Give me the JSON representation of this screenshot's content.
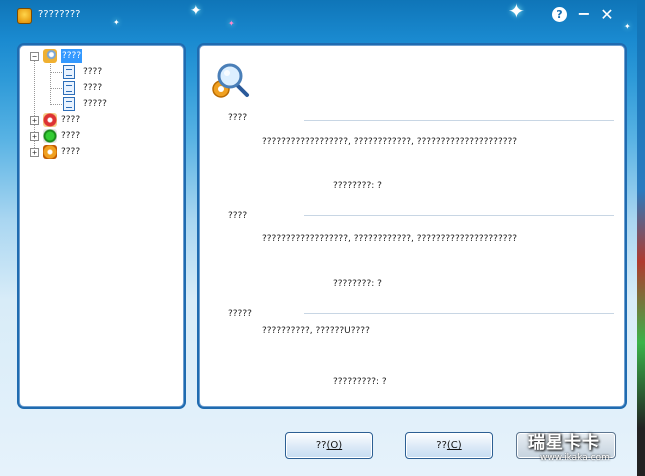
{
  "window": {
    "title": "????????"
  },
  "titlebar": {
    "help": "?",
    "minimize": "−",
    "close": "✕"
  },
  "tree": {
    "items": [
      {
        "label": "????",
        "expander": "−",
        "selected": true
      },
      {
        "label": "????"
      },
      {
        "label": "????"
      },
      {
        "label": "?????"
      },
      {
        "label": "????",
        "expander": "+"
      },
      {
        "label": "????",
        "expander": "+"
      },
      {
        "label": "????",
        "expander": "+"
      }
    ]
  },
  "sections": [
    {
      "heading": "????",
      "text": "??????????????????, ????????????, ?????????????????????",
      "value": "????????:  ?"
    },
    {
      "heading": "????",
      "text": "??????????????????, ????????????, ?????????????????????",
      "value": "????????:  ?"
    },
    {
      "heading": "?????",
      "text": "??????????, ??????U????",
      "value": "?????????:  ?"
    }
  ],
  "buttons": {
    "ok": {
      "label": "??",
      "key": "(O)"
    },
    "cancel": {
      "label": "??",
      "key": "(C)"
    }
  },
  "watermark": {
    "brand": "瑞星卡卡",
    "url": "www.ikaka.com"
  },
  "colors": {
    "accent": "#1a8ad0",
    "selected": "#3399ff"
  }
}
